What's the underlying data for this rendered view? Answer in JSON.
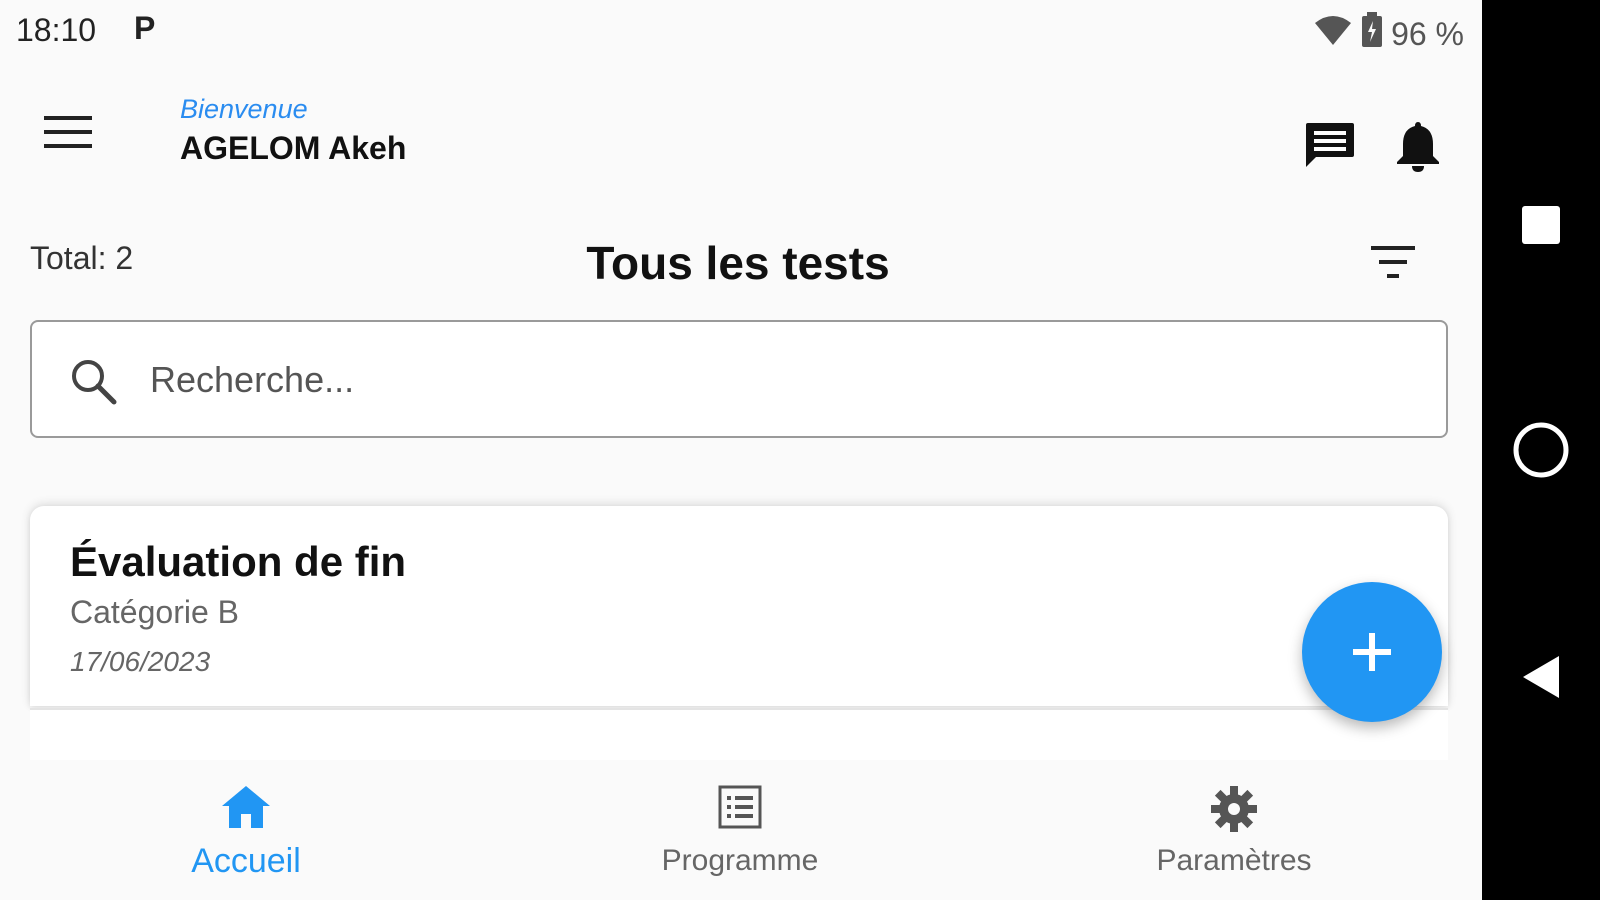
{
  "status_bar": {
    "time": "18:10",
    "app_badge": "P",
    "battery": "96 %"
  },
  "header": {
    "welcome": "Bienvenue",
    "username": "AGELOM Akeh"
  },
  "list_header": {
    "total": "Total: 2",
    "title": "Tous les tests"
  },
  "search": {
    "placeholder": "Recherche..."
  },
  "tests": [
    {
      "title": "Évaluation de fin",
      "category": "Catégorie B",
      "date": "17/06/2023"
    }
  ],
  "bottom_nav": [
    {
      "label": "Accueil",
      "icon": "home-icon",
      "active": true
    },
    {
      "label": "Programme",
      "icon": "list-icon",
      "active": false
    },
    {
      "label": "Paramètres",
      "icon": "gear-icon",
      "active": false
    }
  ],
  "colors": {
    "accent": "#2196f3",
    "welcome_text": "#2a8cf0"
  }
}
